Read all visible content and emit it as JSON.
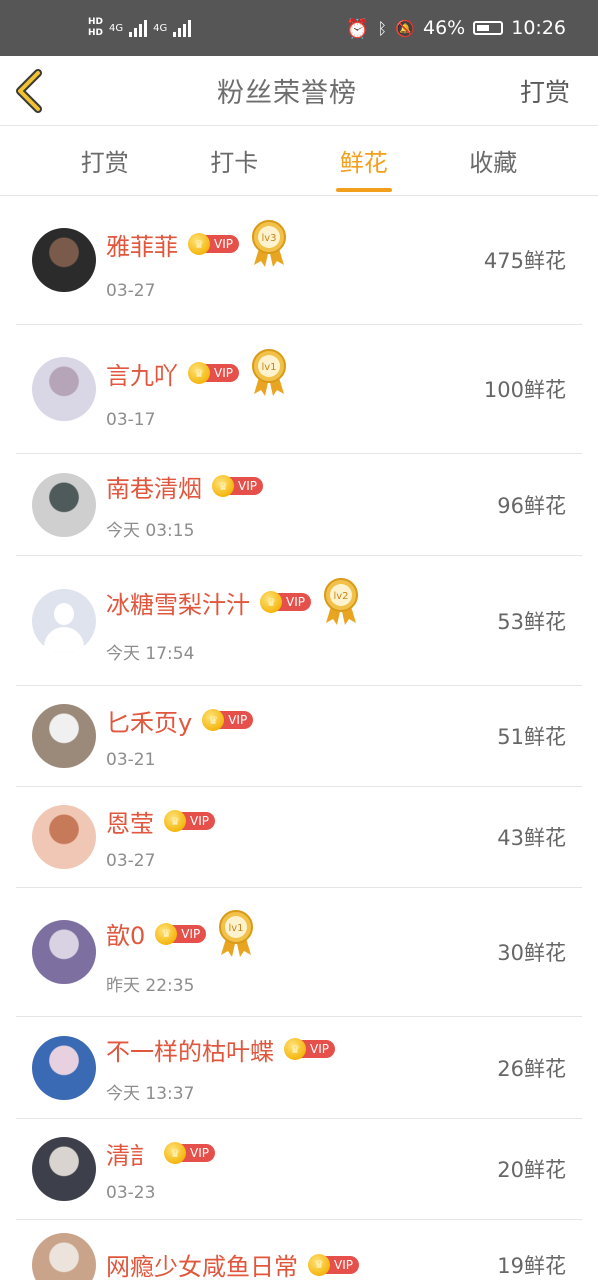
{
  "status_bar": {
    "network_1": "HD",
    "network_2": "HD",
    "signal_label": "4G",
    "battery": "46%",
    "time": "10:26"
  },
  "header": {
    "title": "粉丝荣誉榜",
    "action": "打赏"
  },
  "tabs": [
    {
      "label": "打赏"
    },
    {
      "label": "打卡"
    },
    {
      "label": "鲜花"
    },
    {
      "label": "收藏"
    }
  ],
  "active_tab": "鲜花",
  "vip_label": "VIP",
  "colors": {
    "accent": "#f2a01c",
    "name": "#e0573e",
    "vip": "#e6504a"
  },
  "fans": [
    {
      "name": "雅菲菲",
      "date": "03-27",
      "count": "475鲜花",
      "level": "lv3"
    },
    {
      "name": "言九吖",
      "date": "03-17",
      "count": "100鲜花",
      "level": "lv1"
    },
    {
      "name": "南巷清烟",
      "date": "今天 03:15",
      "count": "96鲜花",
      "level": ""
    },
    {
      "name": "冰糖雪梨汁汁",
      "date": "今天 17:54",
      "count": "53鲜花",
      "level": "lv2"
    },
    {
      "name": "匕禾页y",
      "date": "03-21",
      "count": "51鲜花",
      "level": ""
    },
    {
      "name": "恩莹",
      "date": "03-27",
      "count": "43鲜花",
      "level": ""
    },
    {
      "name": "歆0",
      "date": "昨天 22:35",
      "count": "30鲜花",
      "level": "lv1"
    },
    {
      "name": "不一样的枯叶蝶",
      "date": "今天 13:37",
      "count": "26鲜花",
      "level": ""
    },
    {
      "name": "清訁",
      "date": "03-23",
      "count": "20鲜花",
      "level": ""
    },
    {
      "name": "网瘾少女咸鱼日常",
      "date": "",
      "count": "19鲜花",
      "level": ""
    }
  ]
}
